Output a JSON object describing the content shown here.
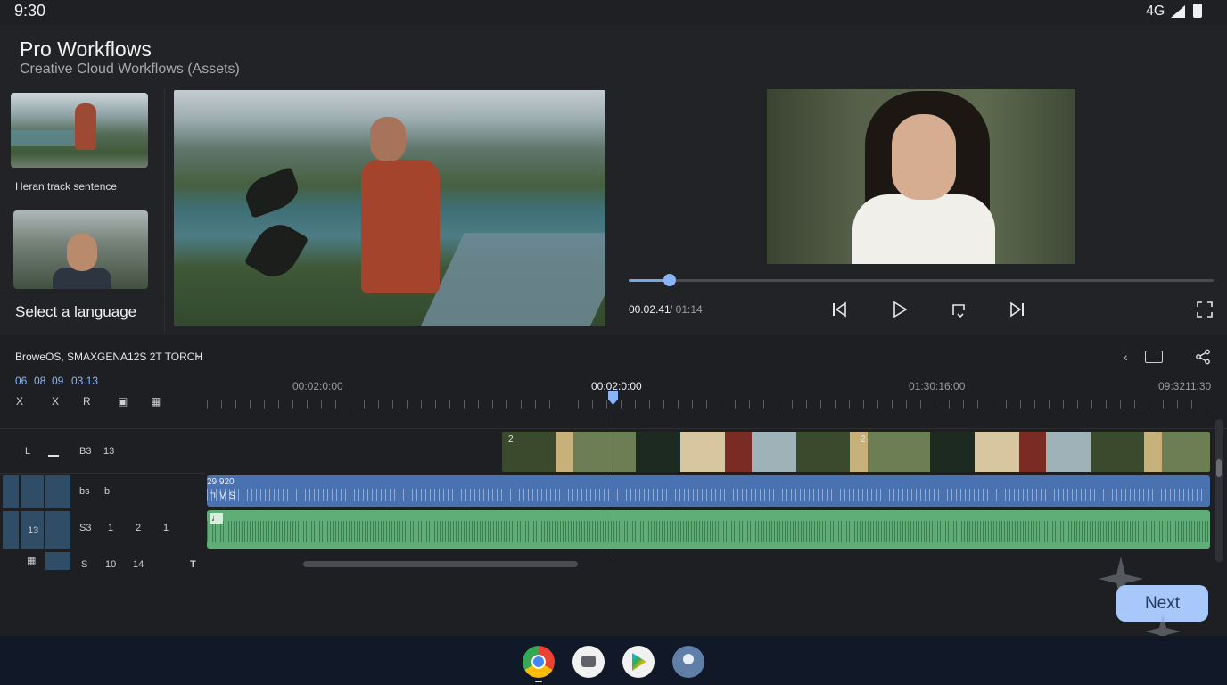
{
  "status_bar": {
    "time": "9:30",
    "network": "4G"
  },
  "header": {
    "title": "Pro Workflows",
    "subtitle": "Creative Cloud Workflows (Assets)"
  },
  "assets": {
    "items": [
      {
        "caption": "Heran track sentence"
      }
    ],
    "language_select": "Select a language"
  },
  "player": {
    "current_time": "00.02.41",
    "total_time": "/ 01:14",
    "progress": 0.07
  },
  "timeline": {
    "breadcrumb": "BroweOS, SMAXGENA12S 2T TORCH",
    "timecode_parts": [
      "06",
      "08",
      "09",
      "03.13"
    ],
    "ruler_labels": [
      "00:02:0:00",
      "00:02:0:00",
      "01:30:16:00",
      "09:3211:30"
    ],
    "tools": [
      "X",
      "X",
      "R",
      "▣",
      "▦"
    ],
    "track_headers": {
      "video": [
        "L",
        "B3",
        "13"
      ],
      "audio1": [
        "bs",
        "b"
      ],
      "audio2": [
        "13",
        "S3",
        "1",
        "2",
        "1"
      ],
      "bottom": [
        "S",
        "10",
        "14",
        "T"
      ]
    },
    "video_strip_labels": [
      "2",
      "2"
    ],
    "audio1_label": "29 920",
    "audio1_glyphs": "ㄱ V S",
    "audio2_glyph": "♩"
  },
  "next_button": {
    "label": "Next"
  },
  "dock": {
    "apps": [
      "chrome-icon",
      "camera-icon",
      "play-store-icon",
      "contacts-icon"
    ]
  },
  "colors": {
    "accent": "#8ab4f8",
    "audio_track_1": "#4a72b0",
    "audio_track_2": "#5fae78",
    "next_button": "#a8c7fa"
  }
}
